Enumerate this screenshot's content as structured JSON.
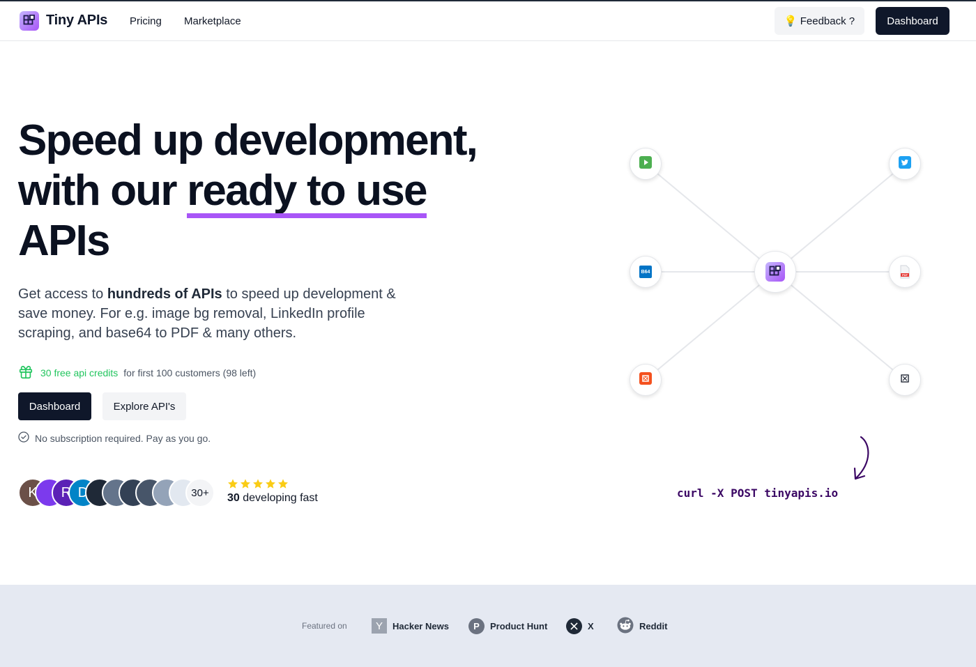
{
  "nav": {
    "brand": "Tiny APIs",
    "links": [
      "Pricing",
      "Marketplace"
    ],
    "feedback_label": "💡 Feedback ?",
    "dashboard_label": "Dashboard"
  },
  "hero": {
    "headline_line1": "Speed up development,",
    "headline_line2_prefix": "with our ",
    "headline_line2_highlight": "ready to use",
    "headline_line3": "APIs",
    "subtitle_pre": "Get access to ",
    "subtitle_bold": "hundreds of APIs",
    "subtitle_post": " to speed up development & save money. For e.g. image bg removal, LinkedIn profile scraping, and base64 to PDF & many others.",
    "credits_highlight": "30 free api credits",
    "credits_text": "for first 100 customers (98 left)",
    "dashboard_button": "Dashboard",
    "explore_button": "Explore API's",
    "no_subscription": "No subscription required. Pay as you go.",
    "avatars": [
      {
        "letter": "K",
        "color": "#6b5048"
      },
      {
        "letter": "",
        "color": "#7c3aed"
      },
      {
        "letter": "R",
        "color": "#5b21b6"
      },
      {
        "letter": "D",
        "color": "#0284c7"
      },
      {
        "letter": "",
        "color": "#1f2937"
      },
      {
        "letter": "",
        "color": "#64748b"
      },
      {
        "letter": "",
        "color": "#334155"
      },
      {
        "letter": "",
        "color": "#475569"
      },
      {
        "letter": "",
        "color": "#94a3b8"
      },
      {
        "letter": "",
        "color": "#e2e8f0"
      }
    ],
    "avatars_more": "30+",
    "rating_stars": 5,
    "rating_count": "30",
    "rating_text": " developing fast"
  },
  "diagram": {
    "b64_label": "B64",
    "pdf_label": "PDF",
    "nodes": [
      "play-icon",
      "twitter-icon",
      "base64-icon",
      "pdf-icon",
      "bg-remove-icon",
      "image-icon"
    ]
  },
  "code_snippet": "curl -X POST tinyapis.io",
  "featured": {
    "label": "Featured on",
    "items": [
      {
        "name": "Hacker News",
        "icon": "Y"
      },
      {
        "name": "Product Hunt",
        "icon": "P"
      },
      {
        "name": "X",
        "icon": "𝕏"
      },
      {
        "name": "Reddit",
        "icon": ""
      }
    ]
  },
  "colors": {
    "accent": "#a855f7",
    "dark": "#0f172a",
    "green": "#22c55e",
    "star": "#facc15",
    "featured_bg": "#e5e9f2"
  }
}
